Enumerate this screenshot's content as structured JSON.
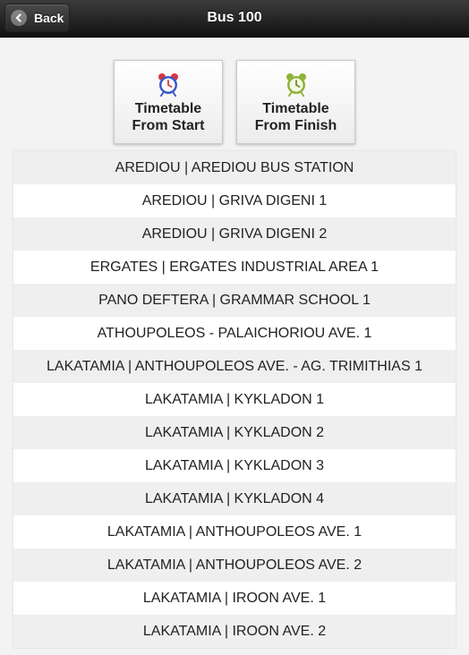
{
  "header": {
    "back_label": "Back",
    "title": "Bus 100"
  },
  "timetable": {
    "start": {
      "line1": "Timetable",
      "line2": "From Start",
      "icon": "alarm-clock-icon",
      "color": "#d9363e"
    },
    "finish": {
      "line1": "Timetable",
      "line2": "From Finish",
      "icon": "alarm-clock-icon",
      "color": "#8fb339"
    }
  },
  "stops": [
    "AREDIOU | AREDIOU BUS STATION",
    "AREDIOU | GRIVA DIGENI 1",
    "AREDIOU | GRIVA DIGENI 2",
    "ERGATES | ERGATES INDUSTRIAL AREA 1",
    "PANO DEFTERA | GRAMMAR SCHOOL 1",
    "ATHOUPOLEOS - PALAICHORIOU AVE. 1",
    "LAKATAMIA | ANTHOUPOLEOS AVE. - AG. TRIMITHIAS 1",
    "LAKATAMIA | KYKLADON 1",
    "LAKATAMIA | KYKLADON 2",
    "LAKATAMIA | KYKLADON 3",
    "LAKATAMIA | KYKLADON 4",
    "LAKATAMIA | ANTHOUPOLEOS AVE. 1",
    "LAKATAMIA | ANTHOUPOLEOS AVE. 2",
    "LAKATAMIA | IROON AVE. 1",
    "LAKATAMIA | IROON AVE. 2"
  ]
}
